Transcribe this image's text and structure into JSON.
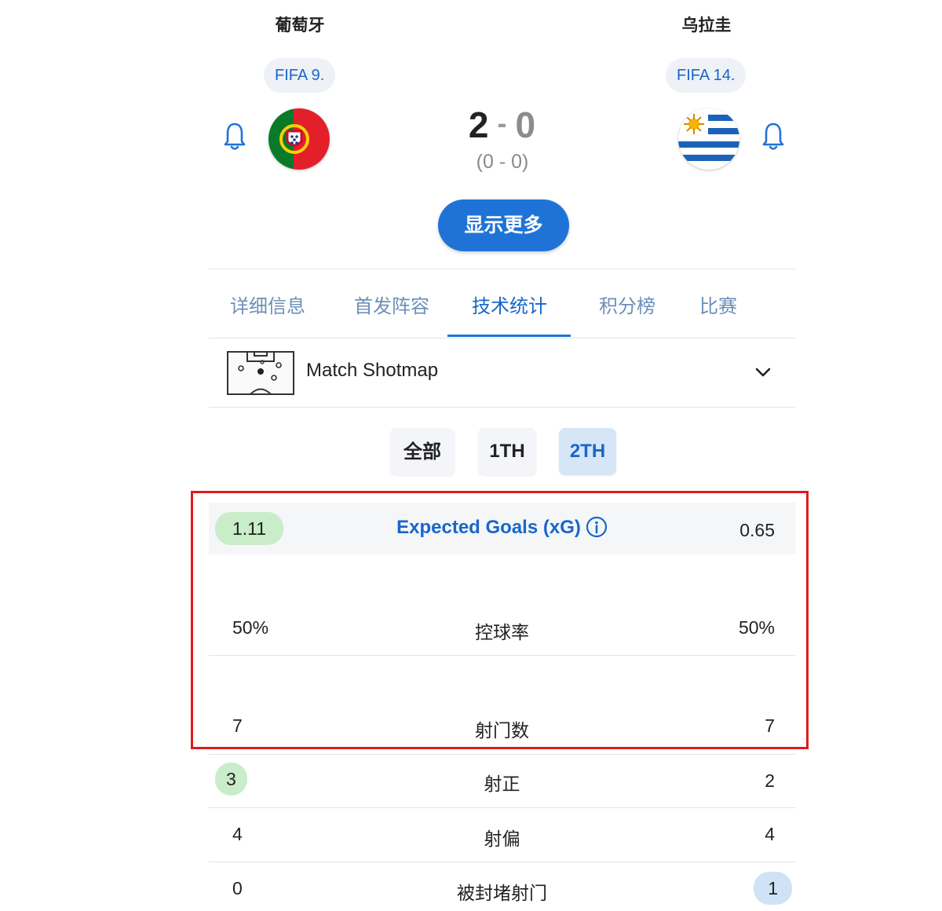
{
  "match": {
    "home": {
      "name": "葡萄牙",
      "rank": "FIFA 9.",
      "score": "2"
    },
    "away": {
      "name": "乌拉圭",
      "rank": "FIFA 14.",
      "score": "0"
    },
    "score_separator": "-",
    "halftime": "(0 - 0)",
    "show_more_label": "显示更多"
  },
  "tabs": [
    {
      "label": "详细信息",
      "active": false
    },
    {
      "label": "首发阵容",
      "active": false
    },
    {
      "label": "技术统计",
      "active": true
    },
    {
      "label": "积分榜",
      "active": false
    },
    {
      "label": "比赛",
      "active": false
    }
  ],
  "shotmap": {
    "label": "Match Shotmap"
  },
  "periods": [
    {
      "label": "全部",
      "selected": false
    },
    {
      "label": "1TH",
      "selected": false
    },
    {
      "label": "2TH",
      "selected": true
    }
  ],
  "stats": [
    {
      "label": "Expected Goals (xG)",
      "home": "1.11",
      "away": "0.65",
      "highlight": "home"
    },
    {
      "label": "控球率",
      "home": "50%",
      "away": "50%",
      "highlight": "none"
    },
    {
      "label": "射门数",
      "home": "7",
      "away": "7",
      "highlight": "none"
    },
    {
      "label": "射正",
      "home": "3",
      "away": "2",
      "highlight": "home"
    },
    {
      "label": "射偏",
      "home": "4",
      "away": "4",
      "highlight": "none"
    },
    {
      "label": "被封堵射门",
      "home": "0",
      "away": "1",
      "highlight": "away"
    }
  ],
  "colors": {
    "accent": "#1f73d6",
    "highlight_home": "#c9ecc9",
    "highlight_away": "#cfe2f6",
    "annotation_box": "#e01b1b"
  },
  "icons": {
    "bell": "bell-icon",
    "pitch": "pitch-icon",
    "chevron": "chevron-down-icon",
    "info": "info-icon"
  }
}
